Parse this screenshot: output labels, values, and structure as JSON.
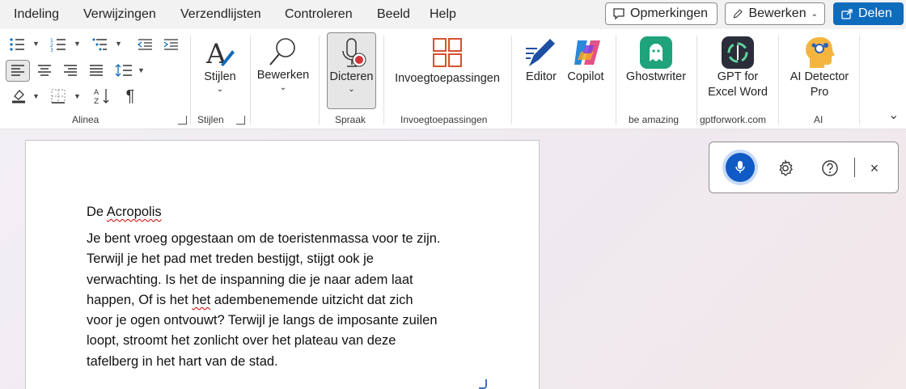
{
  "menu": {
    "items": [
      "Indeling",
      "Verwijzingen",
      "Verzendlijsten",
      "Controleren",
      "Beeld",
      "Help"
    ],
    "comments_label": "Opmerkingen",
    "edit_label": "Bewerken",
    "share_label": "Delen"
  },
  "ribbon": {
    "groups": {
      "alinea": "Alinea",
      "stijlen": "Stijlen",
      "spraak": "Spraak",
      "invoeg": "Invoegtoepassingen",
      "be_amazing": "be amazing",
      "gptforwork": "gptforwork.com",
      "ai": "AI"
    },
    "buttons": {
      "stijlen": "Stijlen",
      "bewerken": "Bewerken",
      "dicteren": "Dicteren",
      "invoegtoepassingen": "Invoegtoepassingen",
      "editor": "Editor",
      "copilot": "Copilot",
      "ghostwriter": "Ghostwriter",
      "gpt_line1": "GPT for",
      "gpt_line2": "Excel Word",
      "ai_line1": "AI Detector",
      "ai_line2": "Pro"
    }
  },
  "document": {
    "title_a": "De ",
    "title_b": "Acropolis",
    "body_1": "Je bent vroeg opgestaan om de toeristenmassa voor te zijn.\nTerwijl je het pad met treden bestijgt, stijgt ook je\nverwachting. Is het de inspanning die je naar adem laat\nhappen, Of is het ",
    "body_err": "het",
    "body_2": " adembenemende uitzicht dat zich\nvoor je ogen ontvouwt? Terwijl je langs de imposante zuilen\nloopt, stroomt het zonlicht over het plateau van deze\ntafelberg in het hart van de stad."
  },
  "dictation": {
    "close_glyph": "×"
  },
  "colors": {
    "accent": "#0f6cbd",
    "mic": "#0f5ac4",
    "invoeg_icon": "#d35230",
    "ghost_green": "#1fa37a",
    "spell_error": "#cc0000"
  },
  "icons": [
    "bullets-icon",
    "numbering-icon",
    "multilevel-list-icon",
    "decrease-indent-icon",
    "increase-indent-icon",
    "align-left-icon",
    "align-center-icon",
    "align-right-icon",
    "justify-icon",
    "line-spacing-icon",
    "shading-icon",
    "borders-icon",
    "sort-icon",
    "pilcrow-icon",
    "comment-icon",
    "pencil-icon",
    "share-icon",
    "styles-icon",
    "search-icon",
    "dictate-mic-icon",
    "addins-grid-icon",
    "editor-icon",
    "copilot-icon",
    "ghostwriter-icon",
    "gpt-icon",
    "ai-detector-icon",
    "chevron-down-icon",
    "mic-icon",
    "gear-icon",
    "help-icon",
    "close-icon"
  ]
}
